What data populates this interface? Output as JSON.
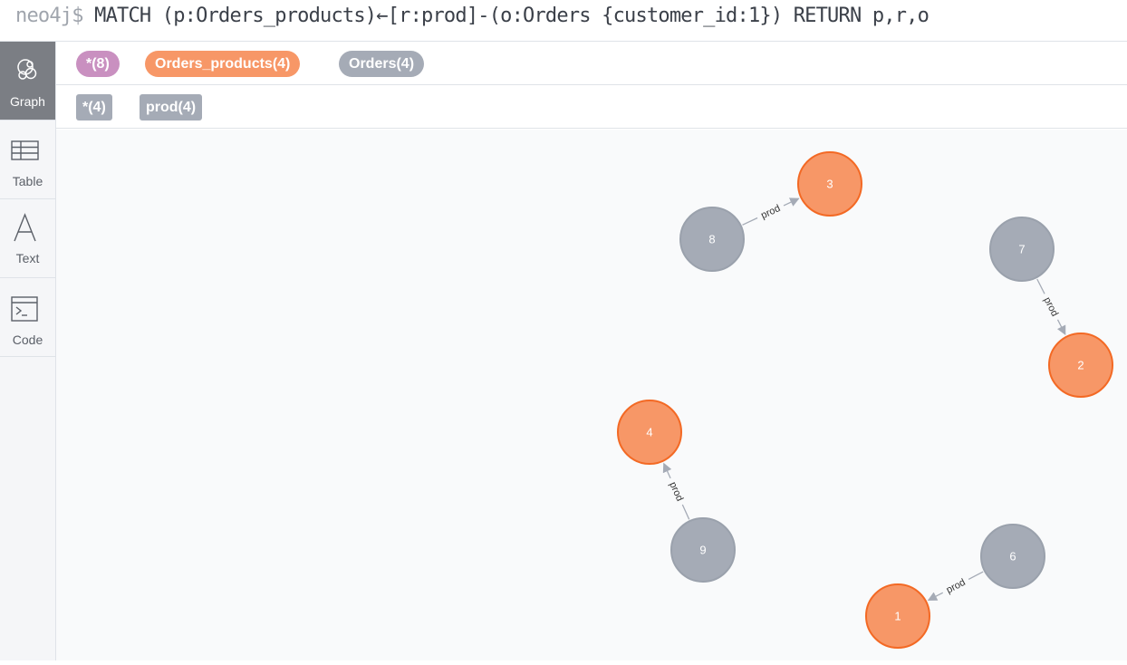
{
  "command": {
    "prompt": "neo4j$",
    "query": "MATCH (p:Orders_products)←[r:prod]-(o:Orders {customer_id:1}) RETURN p,r,o"
  },
  "sidebar": {
    "items": [
      {
        "label": "Graph",
        "icon": "graph-icon",
        "active": true
      },
      {
        "label": "Table",
        "icon": "table-icon",
        "active": false
      },
      {
        "label": "Text",
        "icon": "text-icon",
        "active": false
      },
      {
        "label": "Code",
        "icon": "code-icon",
        "active": false
      }
    ]
  },
  "legend": {
    "node_labels": [
      {
        "text": "*(8)",
        "color": "#c990c0"
      },
      {
        "text": "Orders_products(4)",
        "color": "#f79767"
      },
      {
        "text": "Orders(4)",
        "color": "#a5abb6"
      }
    ],
    "rel_types": [
      {
        "text": "*(4)",
        "color": "#a5abb6"
      },
      {
        "text": "prod(4)",
        "color": "#a5abb6"
      }
    ]
  },
  "graph": {
    "colors": {
      "orders_products": "#f79767",
      "orders_products_stroke": "#f36924",
      "orders": "#a5abb6",
      "orders_stroke": "#9aa1ac",
      "edge": "#a5abb6"
    },
    "nodes": [
      {
        "id": "3",
        "label": "Orders_products"
      },
      {
        "id": "8",
        "label": "Orders"
      },
      {
        "id": "7",
        "label": "Orders"
      },
      {
        "id": "2",
        "label": "Orders_products"
      },
      {
        "id": "4",
        "label": "Orders_products"
      },
      {
        "id": "9",
        "label": "Orders"
      },
      {
        "id": "6",
        "label": "Orders"
      },
      {
        "id": "1",
        "label": "Orders_products"
      }
    ],
    "relationships": [
      {
        "from": "8",
        "to": "3",
        "type": "prod"
      },
      {
        "from": "7",
        "to": "2",
        "type": "prod"
      },
      {
        "from": "9",
        "to": "4",
        "type": "prod"
      },
      {
        "from": "6",
        "to": "1",
        "type": "prod"
      }
    ]
  }
}
